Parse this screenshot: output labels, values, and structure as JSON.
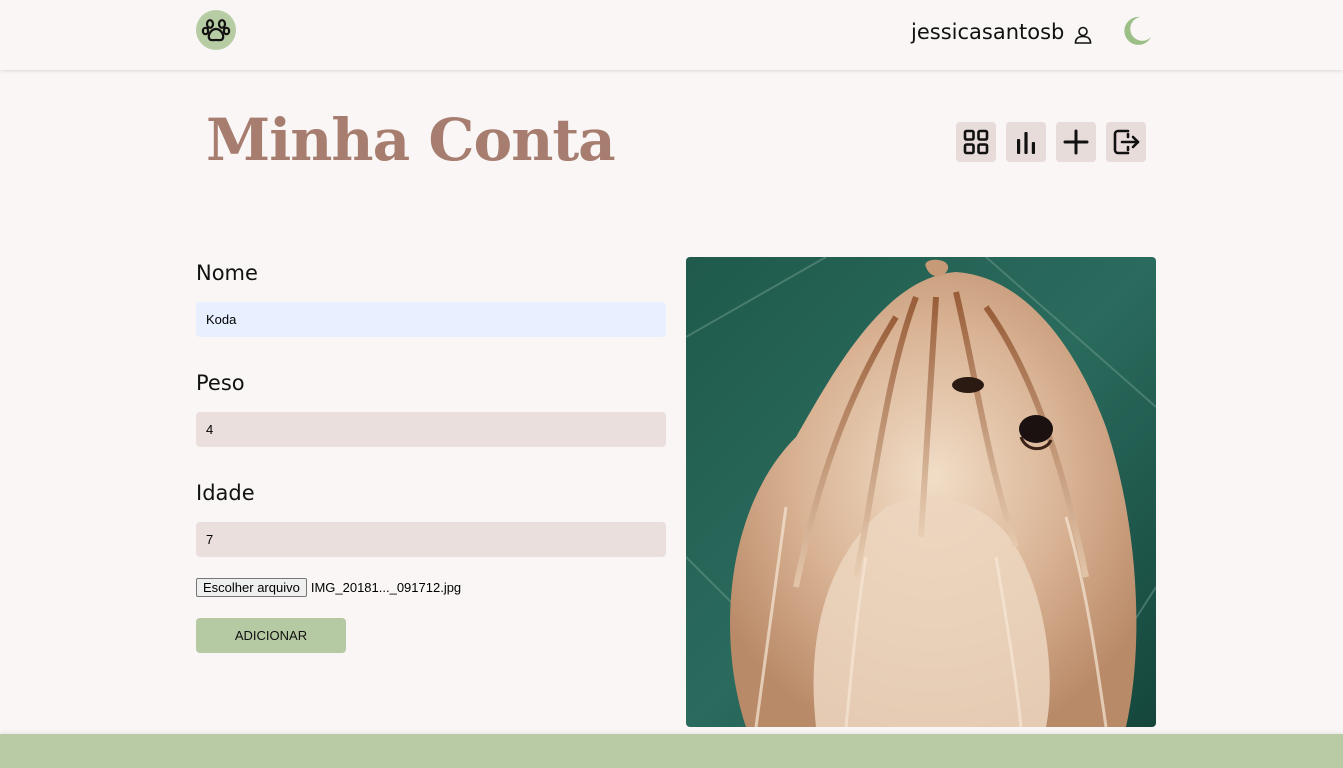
{
  "header": {
    "username": "jessicasantosb",
    "logo_icon": "paw-icon",
    "user_icon": "user-icon",
    "theme_icon": "moon-icon"
  },
  "page": {
    "title": "Minha Conta"
  },
  "toolbar": [
    {
      "name": "grid-icon",
      "label": "feed"
    },
    {
      "name": "bar-chart-icon",
      "label": "estatísticas"
    },
    {
      "name": "plus-icon",
      "label": "adicionar"
    },
    {
      "name": "logout-icon",
      "label": "sair"
    }
  ],
  "form": {
    "nome_label": "Nome",
    "nome_value": "Koda",
    "peso_label": "Peso",
    "peso_value": "4",
    "idade_label": "Idade",
    "idade_value": "7",
    "file_button": "Escolher arquivo",
    "file_name": "IMG_20181..._091712.jpg",
    "submit_label": "ADICIONAR"
  },
  "colors": {
    "accent_green": "#b6cca3",
    "title_brown": "#a77d70",
    "input_bg": "#eadfdd",
    "background": "#f9f6f5"
  }
}
